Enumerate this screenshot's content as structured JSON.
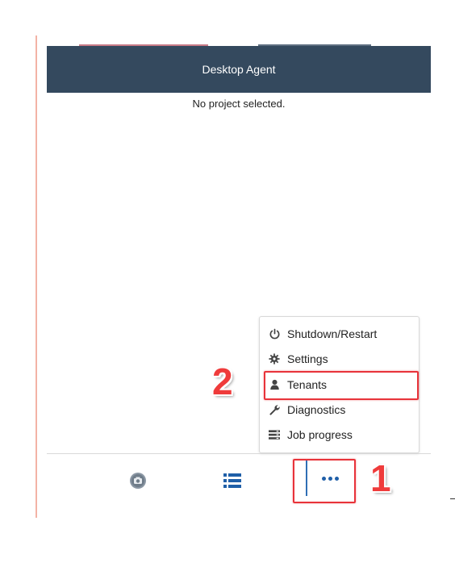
{
  "header": {
    "title": "Desktop Agent"
  },
  "main": {
    "status_text": "No project selected."
  },
  "menu": {
    "items": [
      {
        "label": "Shutdown/Restart",
        "icon": "power-icon"
      },
      {
        "label": "Settings",
        "icon": "gear-icon"
      },
      {
        "label": "Tenants",
        "icon": "user-icon"
      },
      {
        "label": "Diagnostics",
        "icon": "wrench-icon"
      },
      {
        "label": "Job progress",
        "icon": "list-progress-icon"
      }
    ]
  },
  "toolbar": {
    "items": [
      {
        "icon": "camera-icon"
      },
      {
        "icon": "list-icon"
      },
      {
        "icon": "more-dots-icon"
      }
    ]
  },
  "annotations": {
    "step1": "1",
    "step2": "2",
    "highlight_color": "#e8333a"
  },
  "colors": {
    "header_bg": "#34495e",
    "accent_blue": "#1f5fa8"
  }
}
